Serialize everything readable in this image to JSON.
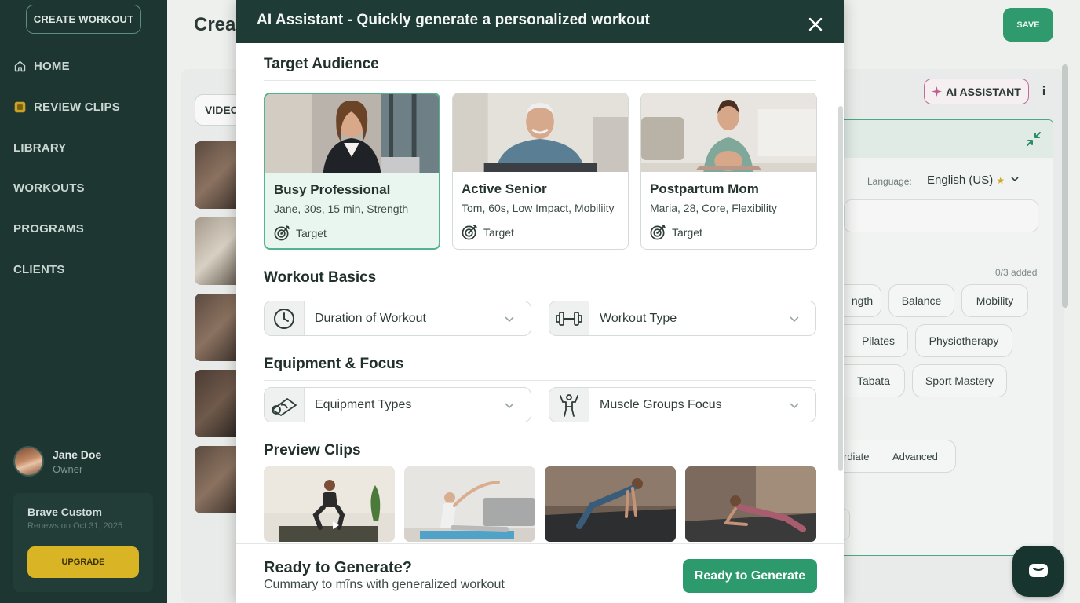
{
  "sidebar": {
    "create_label": "CREATE WORKOUT",
    "items": [
      {
        "label": "HOME",
        "icon": "home-icon"
      },
      {
        "label": "REVIEW CLIPS",
        "icon": "clips-icon"
      },
      {
        "label": "LIBRARY"
      },
      {
        "label": "WORKOUTS"
      },
      {
        "label": "PROGRAMS"
      },
      {
        "label": "CLIENTS"
      }
    ],
    "user": {
      "name": "Jane Doe",
      "role": "Owner"
    },
    "plan": {
      "name": "Brave Custom",
      "renews": "Renews on Oct 31, 2025",
      "upgrade_label": "UPGRADE"
    }
  },
  "header": {
    "title": "Crea",
    "save_label": "SAVE"
  },
  "builder": {
    "video_tab": "VIDEO",
    "ai_assistant_label": "AI ASSISTANT",
    "info_label": "i",
    "language_label": "Language:",
    "language_value": "English (US)",
    "added_count": "0/3 added",
    "chips": [
      "ngth",
      "Balance",
      "Mobility",
      "Pilates",
      "Physiotherapy",
      "Tabata",
      "Sport Mastery",
      "rdiate",
      "Advanced"
    ]
  },
  "modal": {
    "title": "AI Assistant - Quickly generate a personalized workout",
    "sections": {
      "audience": "Target Audience",
      "basics": "Workout Basics",
      "equipment": "Equipment & Focus",
      "preview": "Preview Clips"
    },
    "audiences": [
      {
        "name": "Busy Professional",
        "desc": "Jane, 30s, 15 min, Strength",
        "target_label": "Target",
        "selected": true
      },
      {
        "name": "Active Senior",
        "desc": "Tom, 60s, Low Impact, Mobiliity",
        "target_label": "Target",
        "selected": false
      },
      {
        "name": "Postpartum Mom",
        "desc": "Maria, 28, Core, Flexibility",
        "target_label": "Target",
        "selected": false
      }
    ],
    "selects": {
      "duration": "Duration of Workout",
      "type": "Workout Type",
      "equipment": "Equipment Types",
      "muscles": "Muscle Groups Focus"
    },
    "footer": {
      "title": "Ready to Generate?",
      "subtitle": "Cummary to mĩns with generalized workout",
      "button_label": "Ready to Generate"
    }
  },
  "colors": {
    "sidebar_bg": "#1d3631",
    "modal_header": "#1f3b35",
    "accent_green": "#2c9a6c",
    "selected_card_border": "#55b48f",
    "upgrade_yellow": "#d9b425"
  }
}
